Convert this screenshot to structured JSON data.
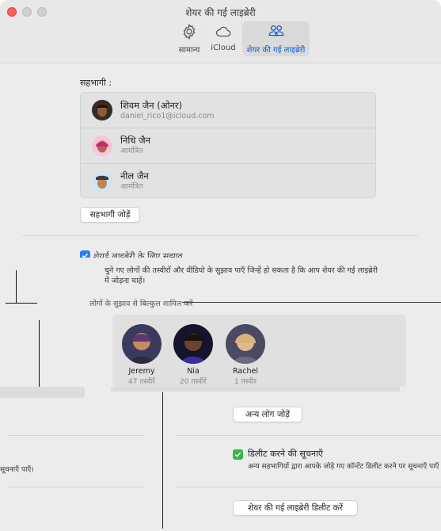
{
  "window": {
    "title": "शेयर की गई लाइब्रेरी"
  },
  "toolbar": {
    "tabs": [
      {
        "label": "सामान्य",
        "icon": "gear-icon"
      },
      {
        "label": "iCloud",
        "icon": "cloud-icon"
      },
      {
        "label": "शेयर की गई लाइब्रेरी",
        "icon": "people-icon"
      }
    ]
  },
  "participants": {
    "heading": "सहभागी :",
    "items": [
      {
        "name": "शिवम जैन (ओनर)",
        "sub": "daniel_rico1@icloud.com"
      },
      {
        "name": "निधि जैन",
        "sub": "आमंत्रित"
      },
      {
        "name": "नील जैन",
        "sub": "आमंत्रित"
      }
    ],
    "add_button": "सहभागी जोड़ें"
  },
  "suggestions": {
    "heading": "शेयर्ड लाइब्रेरी के लिए सुझाव",
    "description": "चुने गए लोगों की तस्वीरों और वीडियो के सुझाव पाएँ जिन्हें हो सकता है कि आप शेयर की गई लाइब्रेरी में जोड़ना चाहें।",
    "people_heading": "लोगों के सुझाव से बिल्कुल शामिल करें"
  },
  "people": [
    {
      "name": "Jeremy",
      "count": "47 तस्वीरें"
    },
    {
      "name": "Nia",
      "count": "20 तस्वीरें"
    },
    {
      "name": "Rachel",
      "count": "1 तस्वीर"
    }
  ],
  "more_people_button": "अन्य लोग जोड़ें",
  "deletion": {
    "heading": "डिलीट करने की सूचनाएँ",
    "description": "अन्य सहभागियों द्वारा आपके जोड़े गए कॉन्टेंट डिलीट करने पर सूचनाएँ पाएँ",
    "left_fragment": "सूचनाएँ पाएँ।"
  },
  "delete_library_button": "शेयर की गई लाइब्रेरी डिलीट करें",
  "colors": {
    "accent": "#0a60d8",
    "checkbox_blue": "#2b7cf7",
    "checkbox_green": "#39b54a"
  }
}
